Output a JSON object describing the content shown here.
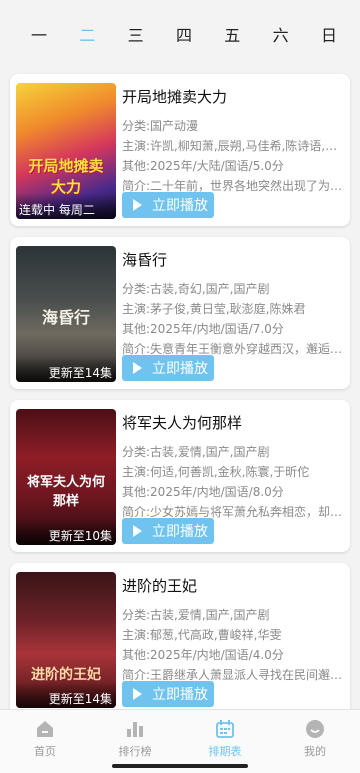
{
  "days": [
    "一",
    "二",
    "三",
    "四",
    "五",
    "六",
    "日"
  ],
  "active_day": 1,
  "play_label": "立即播放",
  "shows": [
    {
      "title": "开局地摊卖大力",
      "category": "分类:国产动漫",
      "cast": "主演:许凯,柳知萧,辰朔,马佳希,陈诗语,由...",
      "other": "其他:2025年/大陆/国语/5.0分",
      "summary": "简介:二十年前，世界各地突然出现了为数...",
      "badge": "连载中 每周二",
      "poster_text": "开局地摊卖大力"
    },
    {
      "title": "海昏行",
      "category": "分类:古装,奇幻,国产,国产剧",
      "cast": "主演:茅子俊,黄日莹,耿澎庭,陈姝君",
      "other": "其他:2025年/内地/国语/7.0分",
      "summary": "简介:失意青年王衡意外穿越西汉，邂逅酷...",
      "badge": "更新至14集",
      "poster_text": "海昏行"
    },
    {
      "title": "将军夫人为何那样",
      "category": "分类:古装,爱情,国产,国产剧",
      "cast": "主演:何适,何善凯,金秋,陈寰,于昕佗",
      "other": "其他:2025年/内地/国语/8.0分",
      "summary": "简介:少女苏嫣与将军萧允私奔相恋，却遭...",
      "badge": "更新至10集",
      "poster_text": "将军夫人为何那样"
    },
    {
      "title": "进阶的王妃",
      "category": "分类:古装,爱情,国产,国产剧",
      "cast": "主演:郁葱,代高政,曹峻祥,华雯",
      "other": "其他:2025年/内地/国语/4.0分",
      "summary": "简介:王爵继承人萧显派人寻找在民间邂逅...",
      "badge": "更新至14集",
      "poster_text": "进阶的王妃"
    }
  ],
  "nav": [
    {
      "label": "首页",
      "icon": "home-icon"
    },
    {
      "label": "排行榜",
      "icon": "bar-chart-icon"
    },
    {
      "label": "排期表",
      "icon": "calendar-icon"
    },
    {
      "label": "我的",
      "icon": "profile-icon"
    }
  ],
  "active_nav": 2,
  "colors": {
    "accent": "#6fc3ee",
    "text": "#111111",
    "muted": "#8a8a8a"
  }
}
